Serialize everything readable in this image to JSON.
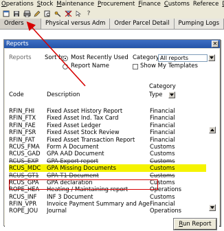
{
  "menubar": {
    "items": [
      {
        "first": "O",
        "rest": "perations"
      },
      {
        "first": "S",
        "rest": "tock"
      },
      {
        "first": "M",
        "rest": "aintenance"
      },
      {
        "first": "P",
        "rest": "rocurement"
      },
      {
        "first": "F",
        "rest": "inance"
      },
      {
        "first": "C",
        "rest": "ustoms"
      },
      {
        "first": "",
        "rest": "Referece"
      },
      {
        "first": "D",
        "rest": "iv"
      }
    ]
  },
  "toolbar": {
    "icons": [
      "new-icon",
      "save-icon",
      "print-icon",
      "edit-icon",
      "preview-icon",
      "key-icon",
      "delete-filter-icon",
      "pointer-icon",
      "help-icon"
    ],
    "help_glyph": "?"
  },
  "tabs": [
    "Orders",
    "Physical versus Adm",
    "Order Parcel Detail",
    "Pumping Logs"
  ],
  "dialog": {
    "title": "Reports",
    "close_glyph": "✕",
    "reports_label": "Reports",
    "sort_by_label": "Sort by",
    "radio_recent": "Most Recently Used",
    "radio_name": "Report Name",
    "category_label": "Category",
    "category_value": "All reports",
    "show_my_templates": "Show My Templates",
    "col_code": "Code",
    "col_description": "Description",
    "col_category_line1": "Category",
    "col_category_line2": "Type",
    "rows": [
      {
        "code": "RFIN_FHI",
        "desc": "Fixed Asset History Report",
        "cat": "Financial"
      },
      {
        "code": "RFIN_FTX",
        "desc": "Fixed Asset Ind. Tax Card",
        "cat": "Financial"
      },
      {
        "code": "RFIN_FAE",
        "desc": "Fixed Asset Ledger",
        "cat": "Financial"
      },
      {
        "code": "RFIN_FSR",
        "desc": "Fixed Asset Stock Review",
        "cat": "Financial"
      },
      {
        "code": "RFIN_FAT",
        "desc": "Fixed Asset Transaction Report",
        "cat": "Financial"
      },
      {
        "code": "RCUS_FMA",
        "desc": "Form A Document",
        "cat": "Customs"
      },
      {
        "code": "RCUS_GAD",
        "desc": "GPA AAD Document",
        "cat": "Customs"
      },
      {
        "code": "RCUS_EXP",
        "desc": "GPA Export report",
        "cat": "Customs"
      },
      {
        "code": "RCUS_MDC",
        "desc": "GPA Missing Documents",
        "cat": "Customs"
      },
      {
        "code": "RCUS_GT1",
        "desc": "GPA T1 Document",
        "cat": "Customs"
      },
      {
        "code": "RCUS_GPA",
        "desc": "GPA declaration",
        "cat": "Customs"
      },
      {
        "code": "ROPE_HEA",
        "desc": "Heating / Maintaining report",
        "cat": "Operations"
      },
      {
        "code": "RCUS_INF",
        "desc": "INF 3 Document",
        "cat": "Customs"
      },
      {
        "code": "RFIN_VPR",
        "desc": "Invoice Payment Summary and Ageing Report",
        "cat": "Financial"
      },
      {
        "code": "ROPE_JOU",
        "desc": "Journal",
        "cat": "Operations"
      }
    ],
    "selected_index": 8,
    "run_first": "R",
    "run_rest": "un Report"
  },
  "colors": {
    "selection": "#f5f300",
    "annotation": "#d60000",
    "title_bar": "#2454a8"
  }
}
